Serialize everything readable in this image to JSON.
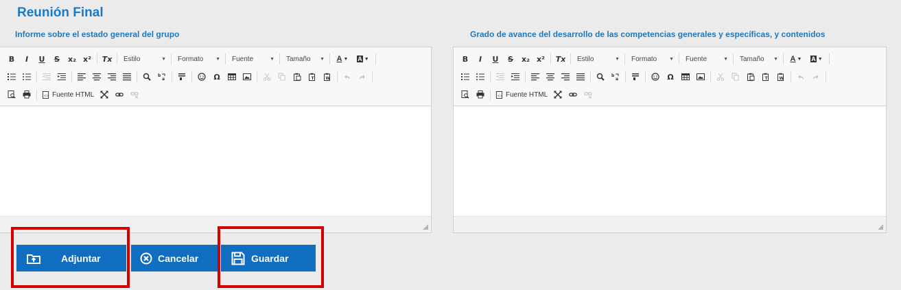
{
  "page": {
    "title": "Reunión Final"
  },
  "sections": {
    "left_label": "Informe sobre el estado general del grupo",
    "right_label": "Grado de avance del desarrollo de las competencias generales y específicas, y contenidos"
  },
  "toolbar": {
    "bold": "B",
    "italic": "I",
    "underline": "U",
    "strike": "S",
    "subscript": "x₂",
    "superscript": "x²",
    "remove_format": "Tx",
    "style_combo": "Estilo",
    "format_combo": "Formato",
    "font_combo": "Fuente",
    "size_combo": "Tamaño",
    "text_color": "A",
    "bg_color": "A",
    "omega": "Ω",
    "source_label": "Fuente HTML"
  },
  "buttons": {
    "attach": "Adjuntar",
    "cancel": "Cancelar",
    "save": "Guardar"
  },
  "colors": {
    "accent": "#0f6ec0",
    "title": "#1a7ac8",
    "highlight": "#d40000"
  }
}
